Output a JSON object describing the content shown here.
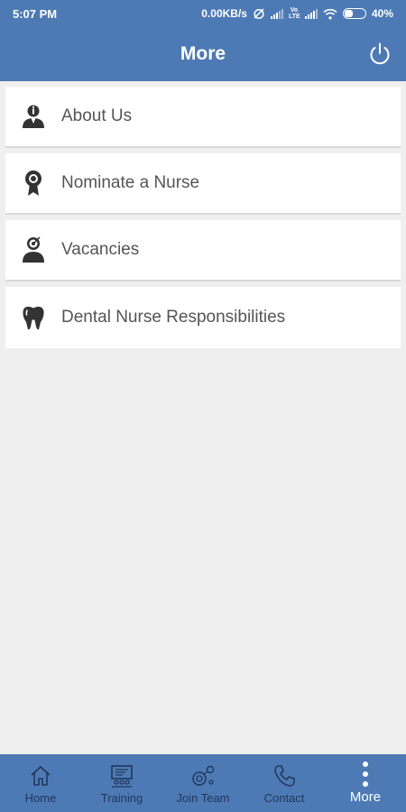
{
  "status_bar": {
    "time": "5:07 PM",
    "network_speed": "0.00KB/s",
    "lte_label": "Vo LTE",
    "battery": "40%",
    "battery_level": 0.4,
    "icons": [
      "alarm-off-icon",
      "signal-icon",
      "signal-icon",
      "wifi-icon",
      "battery-icon"
    ]
  },
  "header": {
    "title": "More",
    "power_icon": "power-icon"
  },
  "menu": {
    "items": [
      {
        "label": "About Us",
        "icon": "info-person-icon"
      },
      {
        "label": "Nominate a Nurse",
        "icon": "award-ribbon-icon"
      },
      {
        "label": "Vacancies",
        "icon": "target-person-icon"
      },
      {
        "label": "Dental Nurse Responsibilities",
        "icon": "tooth-icon"
      }
    ]
  },
  "bottom_nav": {
    "items": [
      {
        "label": "Home",
        "icon": "home-icon"
      },
      {
        "label": "Training",
        "icon": "training-icon"
      },
      {
        "label": "Join Team",
        "icon": "join-team-icon"
      },
      {
        "label": "Contact",
        "icon": "phone-icon"
      },
      {
        "label": "More",
        "icon": "more-vertical-icon",
        "active": true
      }
    ]
  },
  "colors": {
    "primary": "#4d7ab5",
    "background": "#efefef",
    "nav_inactive": "#20375a",
    "menu_text": "#555555"
  }
}
